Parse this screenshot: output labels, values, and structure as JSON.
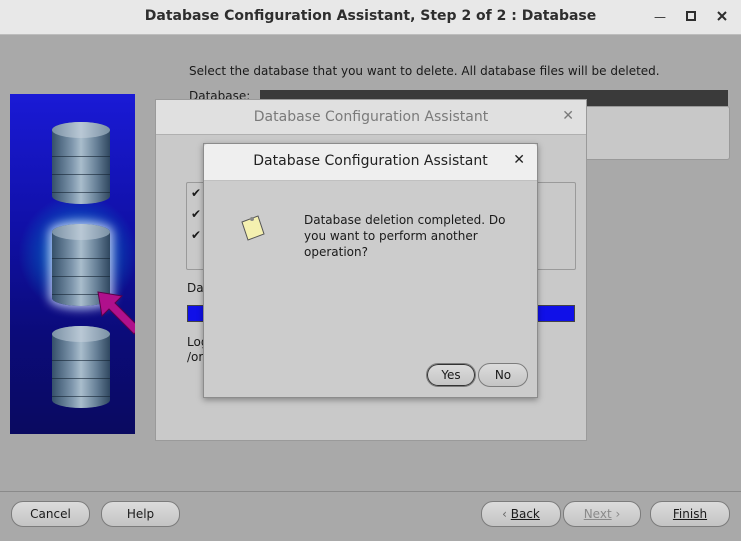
{
  "window": {
    "title": "Database Configuration Assistant, Step 2 of 2 : Database",
    "minimize_icon": "minimize-icon",
    "maximize_icon": "maximize-icon",
    "close_icon": "close-icon"
  },
  "main": {
    "instruction": "Select the database that you want to delete. All database files will be deleted.",
    "database_label": "Database:"
  },
  "progress_dialog": {
    "title": "Database Configuration Assistant",
    "checkmarks": [
      "✔",
      "✔",
      "✔"
    ],
    "data_label": "Dat",
    "log_label_line1": "Log",
    "log_label_line2": "/or",
    "progress": 1.0
  },
  "confirm_dialog": {
    "title": "Database Configuration Assistant",
    "message": "Database deletion completed. Do you want to perform another operation?",
    "yes_label": "Yes",
    "no_label": "No",
    "icon": "note-icon"
  },
  "footer": {
    "cancel_label": "Cancel",
    "help_label": "Help",
    "back_label": "Back",
    "next_label": "Next",
    "finish_label": "Finish"
  },
  "colors": {
    "progress": "#1010e8",
    "art_background": "#1010a6",
    "arrow": "#b0108c"
  }
}
